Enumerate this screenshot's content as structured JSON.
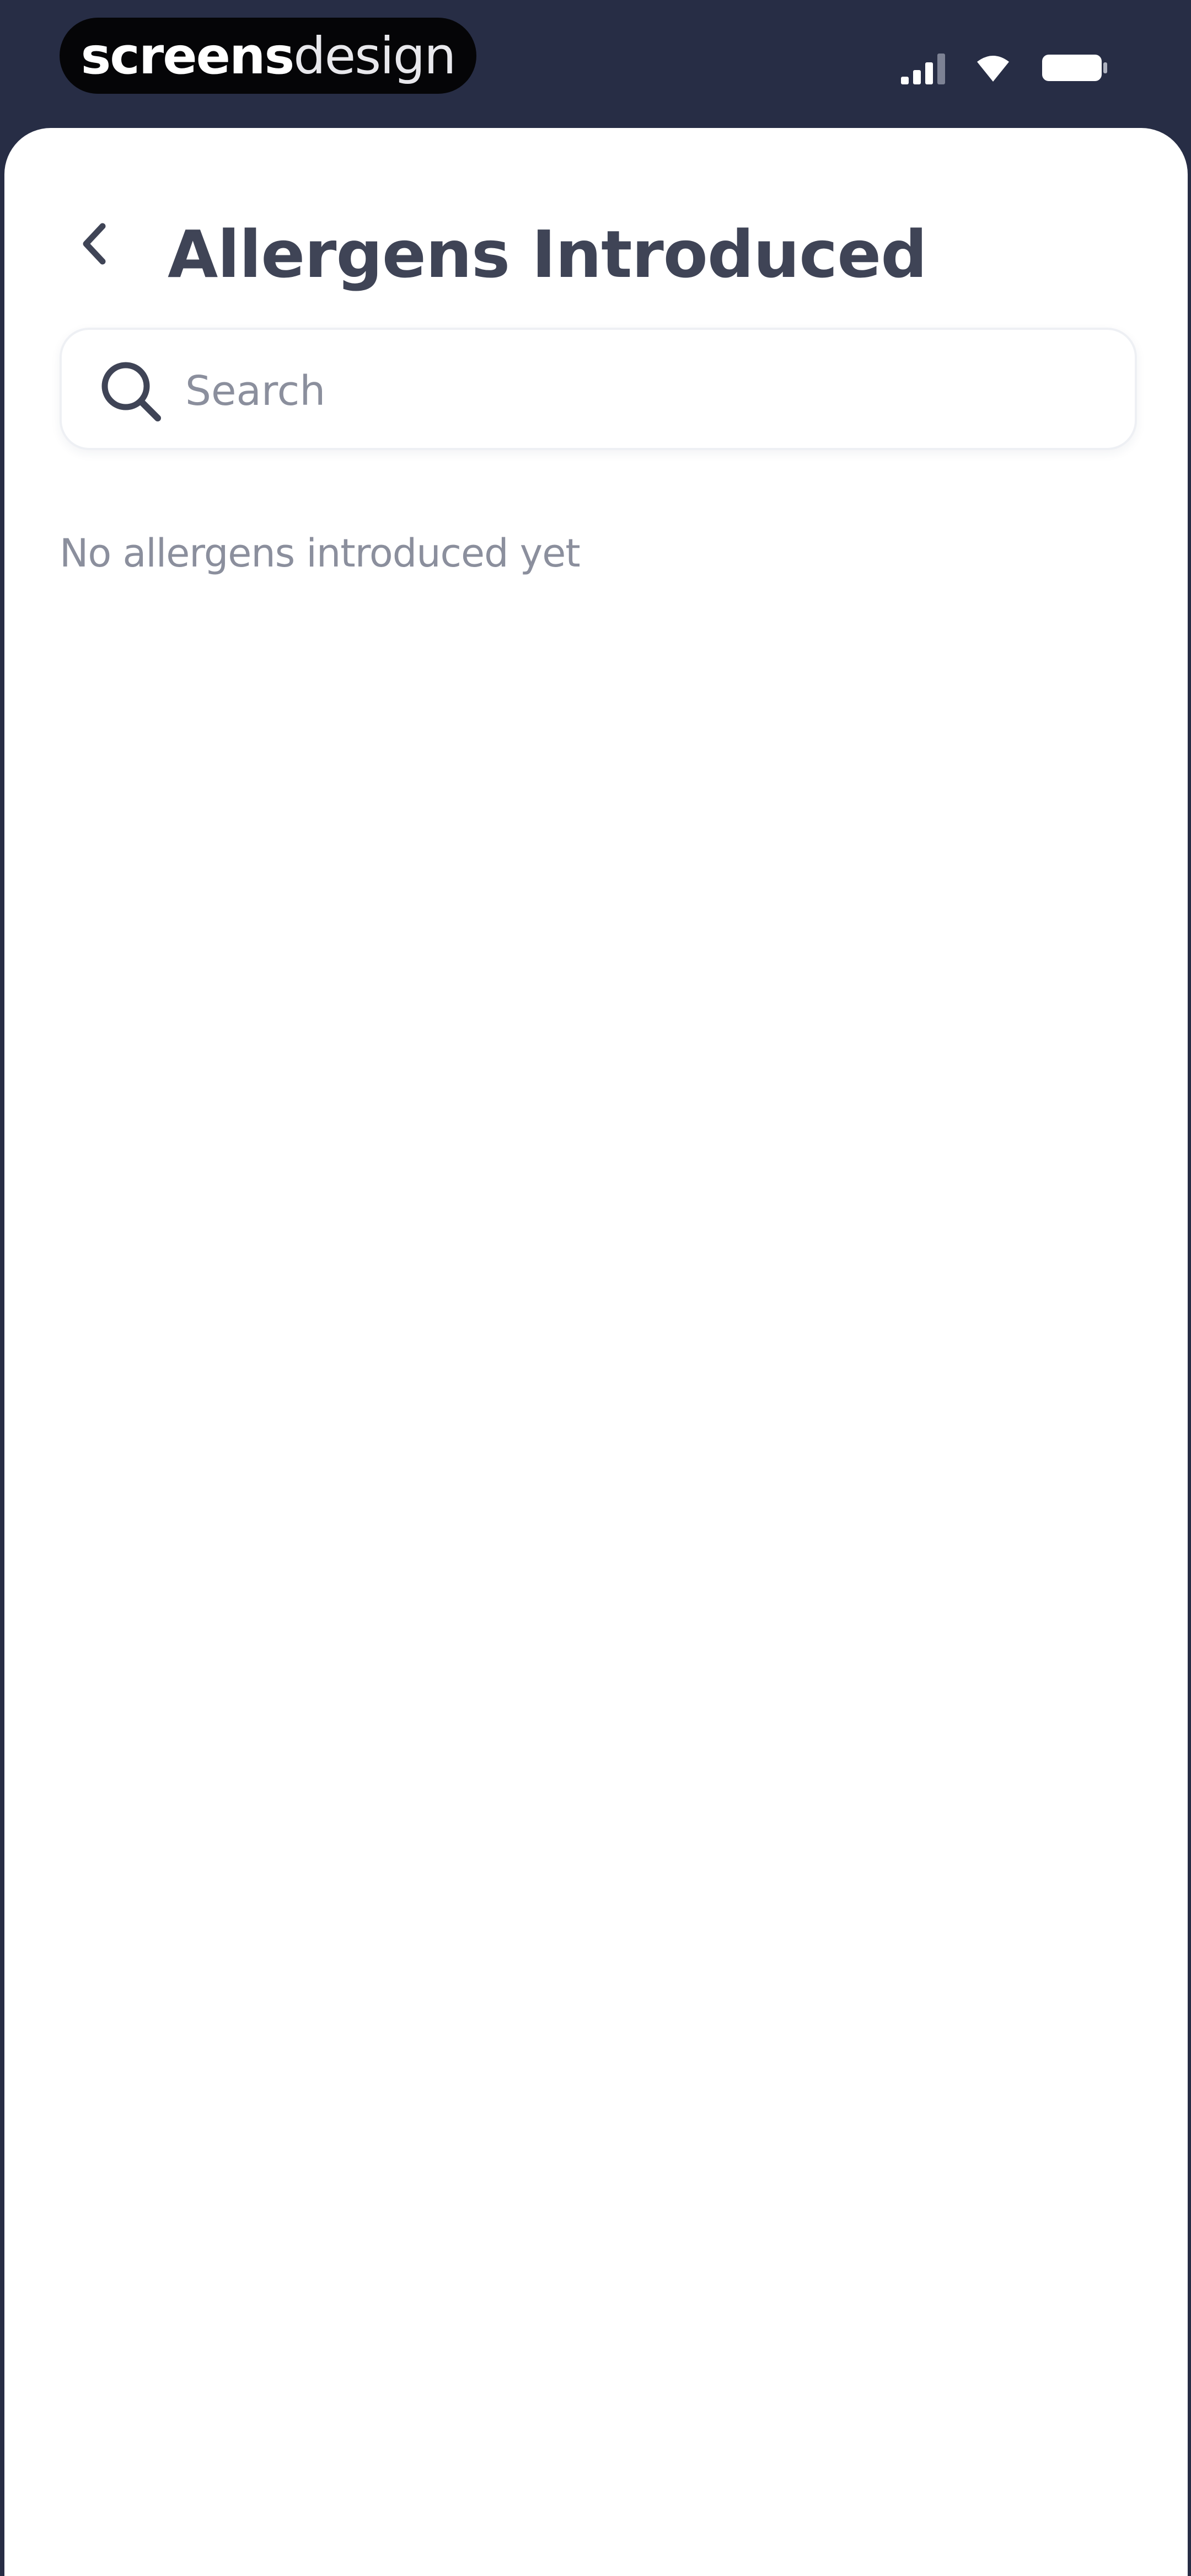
{
  "status_bar": {
    "brand_bold": "screens",
    "brand_light": "design",
    "icons": [
      "signal-icon",
      "wifi-icon",
      "battery-icon"
    ]
  },
  "header": {
    "back_icon": "chevron-left-icon",
    "title": "Allergens Introduced"
  },
  "search": {
    "icon": "search-icon",
    "placeholder": "Search",
    "value": ""
  },
  "empty_state": {
    "message": "No allergens introduced yet"
  },
  "colors": {
    "status_bar_bg": "#272d45",
    "sheet_bg": "#ffffff",
    "title_text": "#3f4456",
    "muted_text": "#8b8f9d"
  }
}
